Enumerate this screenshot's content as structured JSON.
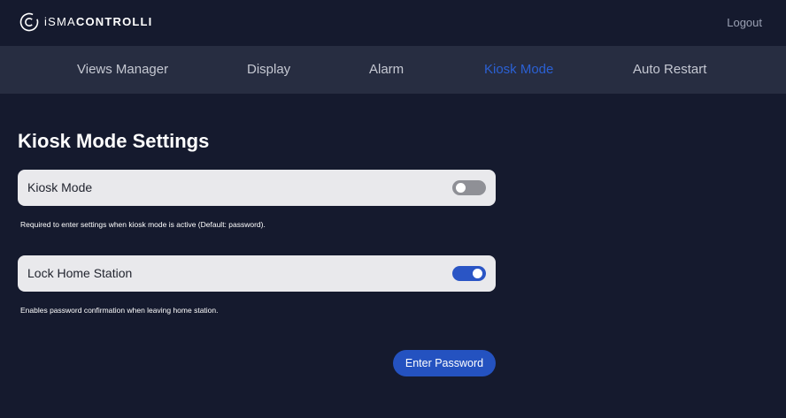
{
  "header": {
    "logo_part1": "iSMA",
    "logo_part2": "CONTROLLI",
    "logout_label": "Logout"
  },
  "nav": {
    "items": [
      {
        "label": "Views Manager",
        "active": false
      },
      {
        "label": "Display",
        "active": false
      },
      {
        "label": "Alarm",
        "active": false
      },
      {
        "label": "Kiosk Mode",
        "active": true
      },
      {
        "label": "Auto Restart",
        "active": false
      }
    ]
  },
  "main": {
    "title": "Kiosk Mode Settings",
    "settings": [
      {
        "label": "Kiosk Mode",
        "enabled": false,
        "help": "Required to enter settings when kiosk mode is active (Default: password)."
      },
      {
        "label": "Lock Home Station",
        "enabled": true,
        "help": "Enables password confirmation when leaving home station."
      }
    ],
    "enter_password_label": "Enter Password"
  },
  "colors": {
    "background": "#151a2e",
    "nav_background": "#272d41",
    "accent": "#2452c0",
    "active_tab": "#2b60d3"
  },
  "icons": {
    "logo": "isma-controlli-logo-icon"
  }
}
